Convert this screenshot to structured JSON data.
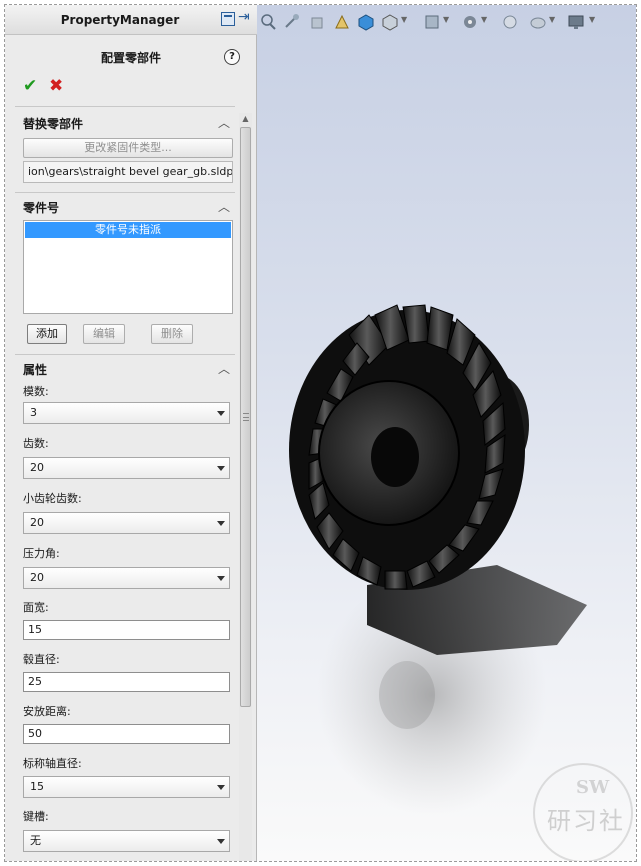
{
  "panel": {
    "title": "PropertyManager",
    "feature_title": "配置零部件",
    "help": "?",
    "ok_icon": "checkmark-icon",
    "cancel_icon": "close-icon"
  },
  "replace_section": {
    "header": "替换零部件",
    "change_button": "更改紧固件类型...",
    "path": "ion\\gears\\straight bevel gear_gb.sldprt"
  },
  "part_number_section": {
    "header": "零件号",
    "items": [
      "零件号未指派"
    ],
    "add_button": "添加",
    "edit_button": "编辑",
    "delete_button": "删除"
  },
  "properties_section": {
    "header": "属性",
    "fields": [
      {
        "label": "模数:",
        "value": "3",
        "type": "select"
      },
      {
        "label": "齿数:",
        "value": "20",
        "type": "select"
      },
      {
        "label": "小齿轮齿数:",
        "value": "20",
        "type": "select"
      },
      {
        "label": "压力角:",
        "value": "20",
        "type": "select"
      },
      {
        "label": "面宽:",
        "value": "15",
        "type": "text"
      },
      {
        "label": "毂直径:",
        "value": "25",
        "type": "text"
      },
      {
        "label": "安放距离:",
        "value": "50",
        "type": "text"
      },
      {
        "label": "标称轴直径:",
        "value": "15",
        "type": "select"
      },
      {
        "label": "键槽:",
        "value": "无",
        "type": "select"
      }
    ]
  },
  "watermark": {
    "line1": "SW",
    "line2": "研习社"
  },
  "colors": {
    "accept": "#1f9a1f",
    "cancel": "#d21e1e",
    "selection": "#3399ff",
    "viewport_top": "#c7d0e4"
  }
}
